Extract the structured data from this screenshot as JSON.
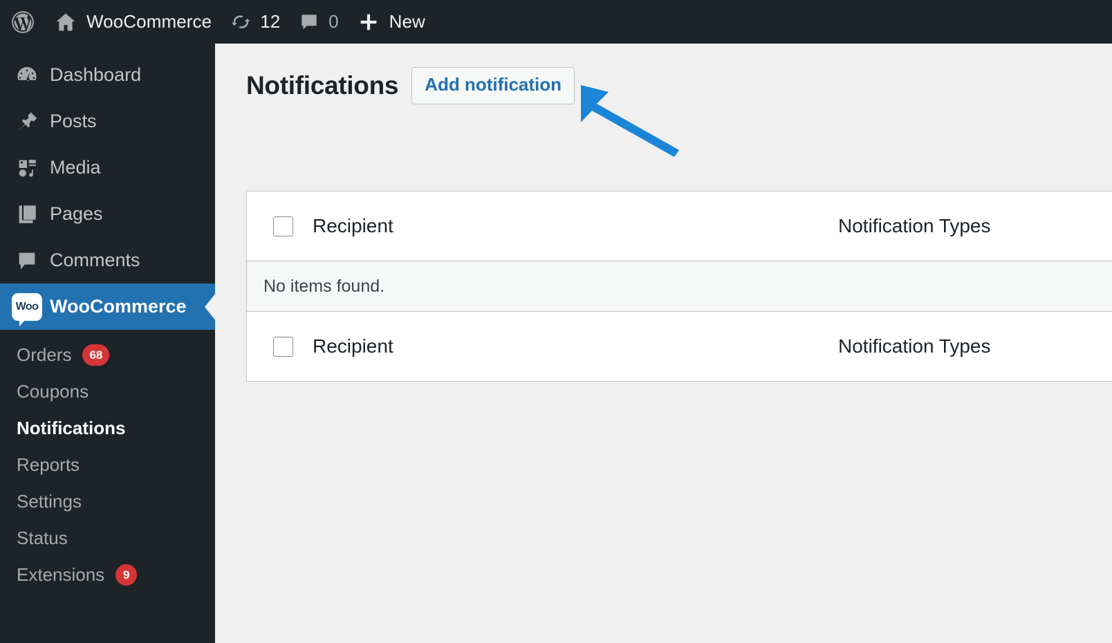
{
  "adminbar": {
    "items": [
      {
        "icon": "wordpress-logo-icon",
        "label": "",
        "type": "logo"
      },
      {
        "icon": "home-icon",
        "label": "WooCommerce",
        "type": "site"
      },
      {
        "icon": "updates-icon",
        "label": "12",
        "type": "updates"
      },
      {
        "icon": "comment-bubble-icon",
        "label": "0",
        "type": "comments"
      },
      {
        "icon": "plus-icon",
        "label": "New",
        "type": "new"
      }
    ],
    "site_name": "WooCommerce",
    "updates_count": "12",
    "comments_count": "0",
    "new_label": "New"
  },
  "sidebar": {
    "background": "#1d2327",
    "current_color": "#2271b1",
    "items": [
      {
        "label": "Dashboard",
        "icon": "dashboard-gauge-icon",
        "current": false
      },
      {
        "label": "Posts",
        "icon": "pin-icon",
        "current": false
      },
      {
        "label": "Media",
        "icon": "media-camera-music-icon",
        "current": false
      },
      {
        "label": "Pages",
        "icon": "pages-icon",
        "current": false
      },
      {
        "label": "Comments",
        "icon": "comment-bubble-icon",
        "current": false
      },
      {
        "label": "WooCommerce",
        "icon": "woocommerce-icon",
        "current": true
      }
    ],
    "submenu": [
      {
        "label": "Orders",
        "badge": "68",
        "current": false
      },
      {
        "label": "Coupons",
        "badge": "",
        "current": false
      },
      {
        "label": "Notifications",
        "badge": "",
        "current": true
      },
      {
        "label": "Reports",
        "badge": "",
        "current": false
      },
      {
        "label": "Settings",
        "badge": "",
        "current": false
      },
      {
        "label": "Status",
        "badge": "",
        "current": false
      },
      {
        "label": "Extensions",
        "badge": "9",
        "current": false
      }
    ],
    "badge_color": "#d63638"
  },
  "page": {
    "title": "Notifications",
    "add_button_label": "Add notification",
    "add_button_text_color": "#2271b1"
  },
  "table": {
    "columns": {
      "recipient": "Recipient",
      "notification_types": "Notification Types"
    },
    "empty_message": "No items found.",
    "rows": []
  },
  "annotation": {
    "type": "arrow",
    "color": "#1b86d8",
    "points_to": "Add notification"
  }
}
